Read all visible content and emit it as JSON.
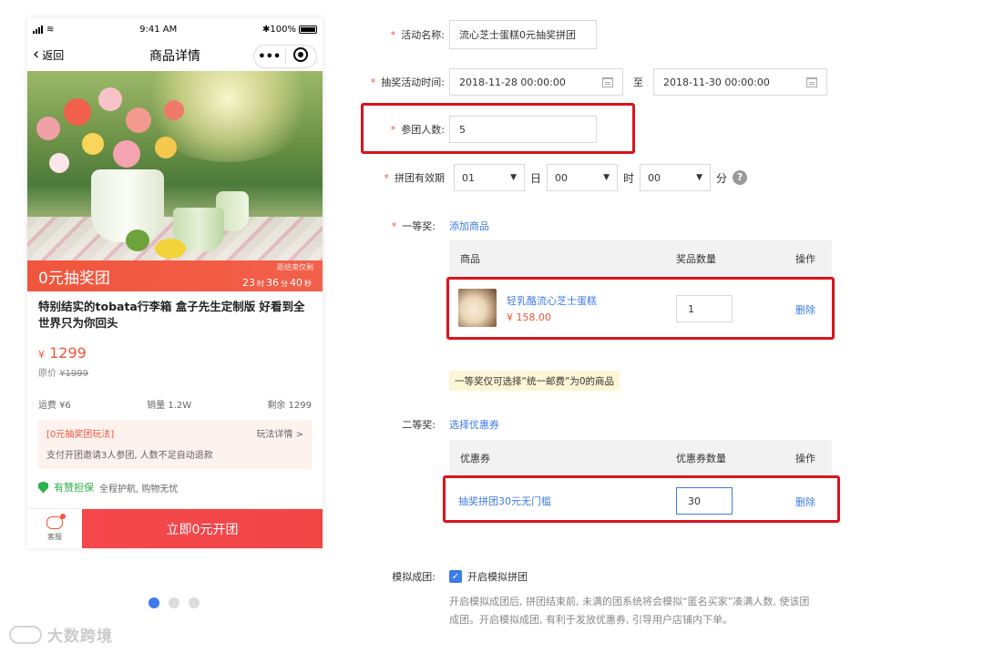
{
  "phone": {
    "status": {
      "time": "9:41 AM",
      "battery": "100%"
    },
    "nav": {
      "back_label": "返回",
      "title": "商品详情",
      "more": "•••"
    },
    "promo": {
      "title": "0元抽奖团",
      "countdown_label": "距结束仅剩",
      "days": "23",
      "d_unit": "时",
      "hours": "36",
      "h_unit": "分",
      "mins": "40",
      "m_unit": "秒"
    },
    "product": {
      "name": "特别结实的tobata行李箱 盒子先生定制版 好看到全世界只为你回头",
      "price_symbol": "¥",
      "price": "1299",
      "orig_label": "原价",
      "orig_price": "¥1999"
    },
    "stats": {
      "shipping": "运费 ¥6",
      "sales": "销量 1.2W",
      "stock": "剩余 1299"
    },
    "rules": {
      "tag": "[0元抽奖团玩法]",
      "link": "玩法详情 >",
      "desc": "支付开团邀请3人参团, 人数不足自动退款"
    },
    "guarantee": {
      "title": "有赞担保",
      "desc": "全程护航, 购物无忧"
    },
    "bottom": {
      "service_label": "客服",
      "open_button": "立即0元开团"
    }
  },
  "carousel": {
    "count": 3,
    "active": 0
  },
  "watermark": "大数跨境",
  "form": {
    "activity_name": {
      "label": "活动名称:",
      "value": "流心芝士蛋糕0元抽奖拼团"
    },
    "time": {
      "label": "抽奖活动时间:",
      "start": "2018-11-28 00:00:00",
      "to": "至",
      "end": "2018-11-30 00:00:00"
    },
    "group_size": {
      "label": "参团人数:",
      "value": "5"
    },
    "validity": {
      "label": "拼团有效期",
      "day": "01",
      "day_unit": "日",
      "hour": "00",
      "hour_unit": "时",
      "minute": "00",
      "minute_unit": "分",
      "help": "?"
    },
    "first_prize": {
      "label": "一等奖:",
      "add_link": "添加商品",
      "headers": [
        "商品",
        "奖品数量",
        "操作"
      ],
      "item": {
        "name": "轻乳酪流心芝士蛋糕",
        "price": "¥ 158.00",
        "qty": "1",
        "action": "删除"
      },
      "tip": "一等奖仅可选择“统一邮费”为0的商品"
    },
    "second_prize": {
      "label": "二等奖:",
      "select_link": "选择优惠券",
      "headers": [
        "优惠券",
        "优惠券数量",
        "操作"
      ],
      "item": {
        "name": "抽奖拼团30元无门槛",
        "qty": "30",
        "action": "删除"
      }
    },
    "simulate": {
      "label": "模拟成团:",
      "checkbox_label": "开启模拟拼团",
      "desc1": "开启模拟成团后, 拼团结束前, 未满的团系统将会模拟“匿名买家”凑满人数, 使该团",
      "desc2": "成团。开启模拟成团, 有利于发放优惠券, 引导用户店铺内下单。"
    }
  },
  "colors": {
    "accent": "#f1553d",
    "link": "#3c7be8",
    "highlight": "#d9141c"
  }
}
